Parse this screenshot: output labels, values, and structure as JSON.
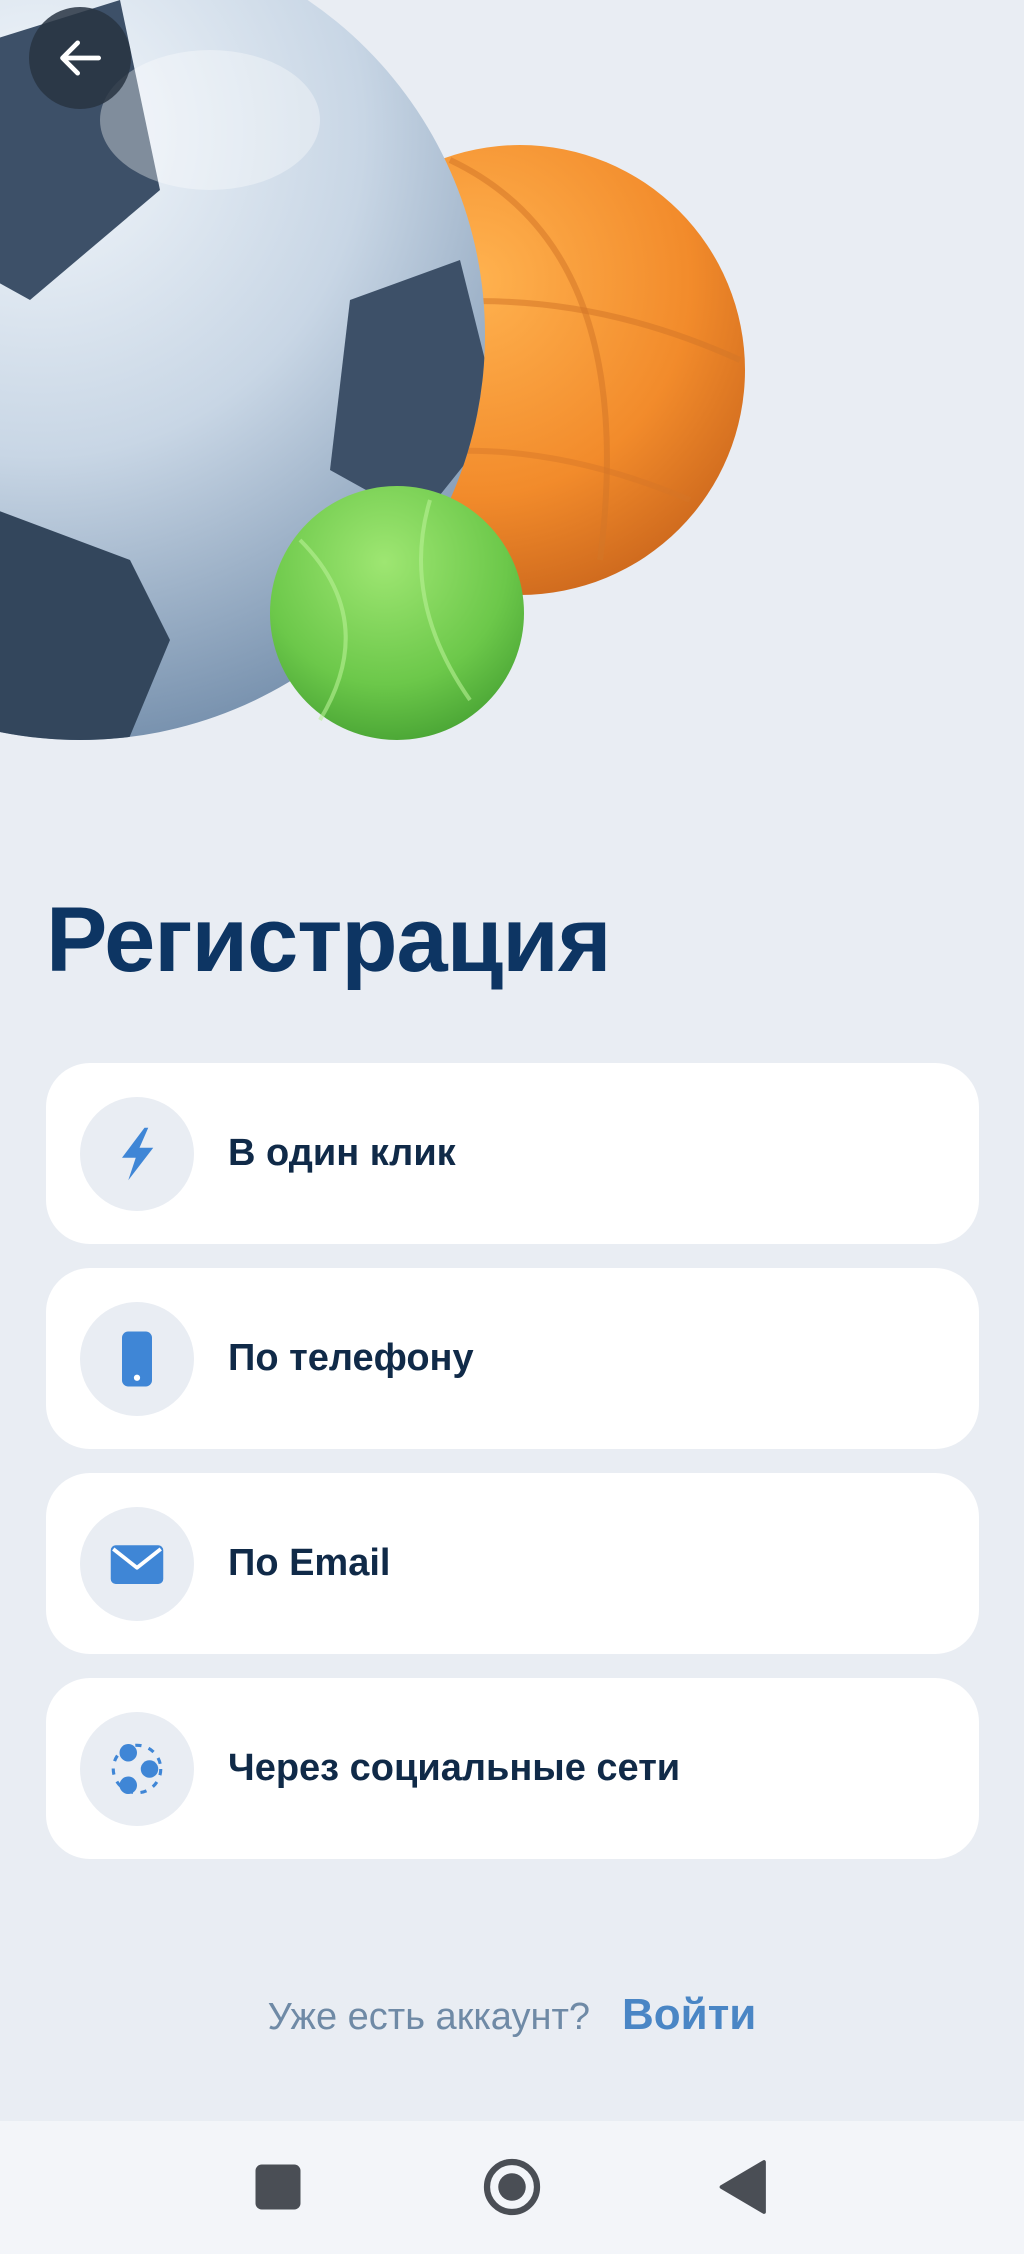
{
  "header": {
    "back_icon": "arrow-left-icon"
  },
  "title": "Регистрация",
  "options": [
    {
      "label": "В один клик",
      "icon": "lightning-icon"
    },
    {
      "label": "По телефону",
      "icon": "phone-icon"
    },
    {
      "label": "По Email",
      "icon": "envelope-icon"
    },
    {
      "label": "Через социальные сети",
      "icon": "social-network-icon"
    }
  ],
  "login": {
    "question": "Уже есть аккаунт?",
    "link_label": "Войти"
  },
  "navigation_bar": {
    "recents_icon": "square-icon",
    "home_icon": "circle-icon",
    "back_icon": "triangle-back-icon"
  },
  "colors": {
    "background": "#e9edf3",
    "title": "#0d3563",
    "accent": "#4a86c5",
    "icon_blue": "#3f86d6",
    "card": "#ffffff"
  }
}
